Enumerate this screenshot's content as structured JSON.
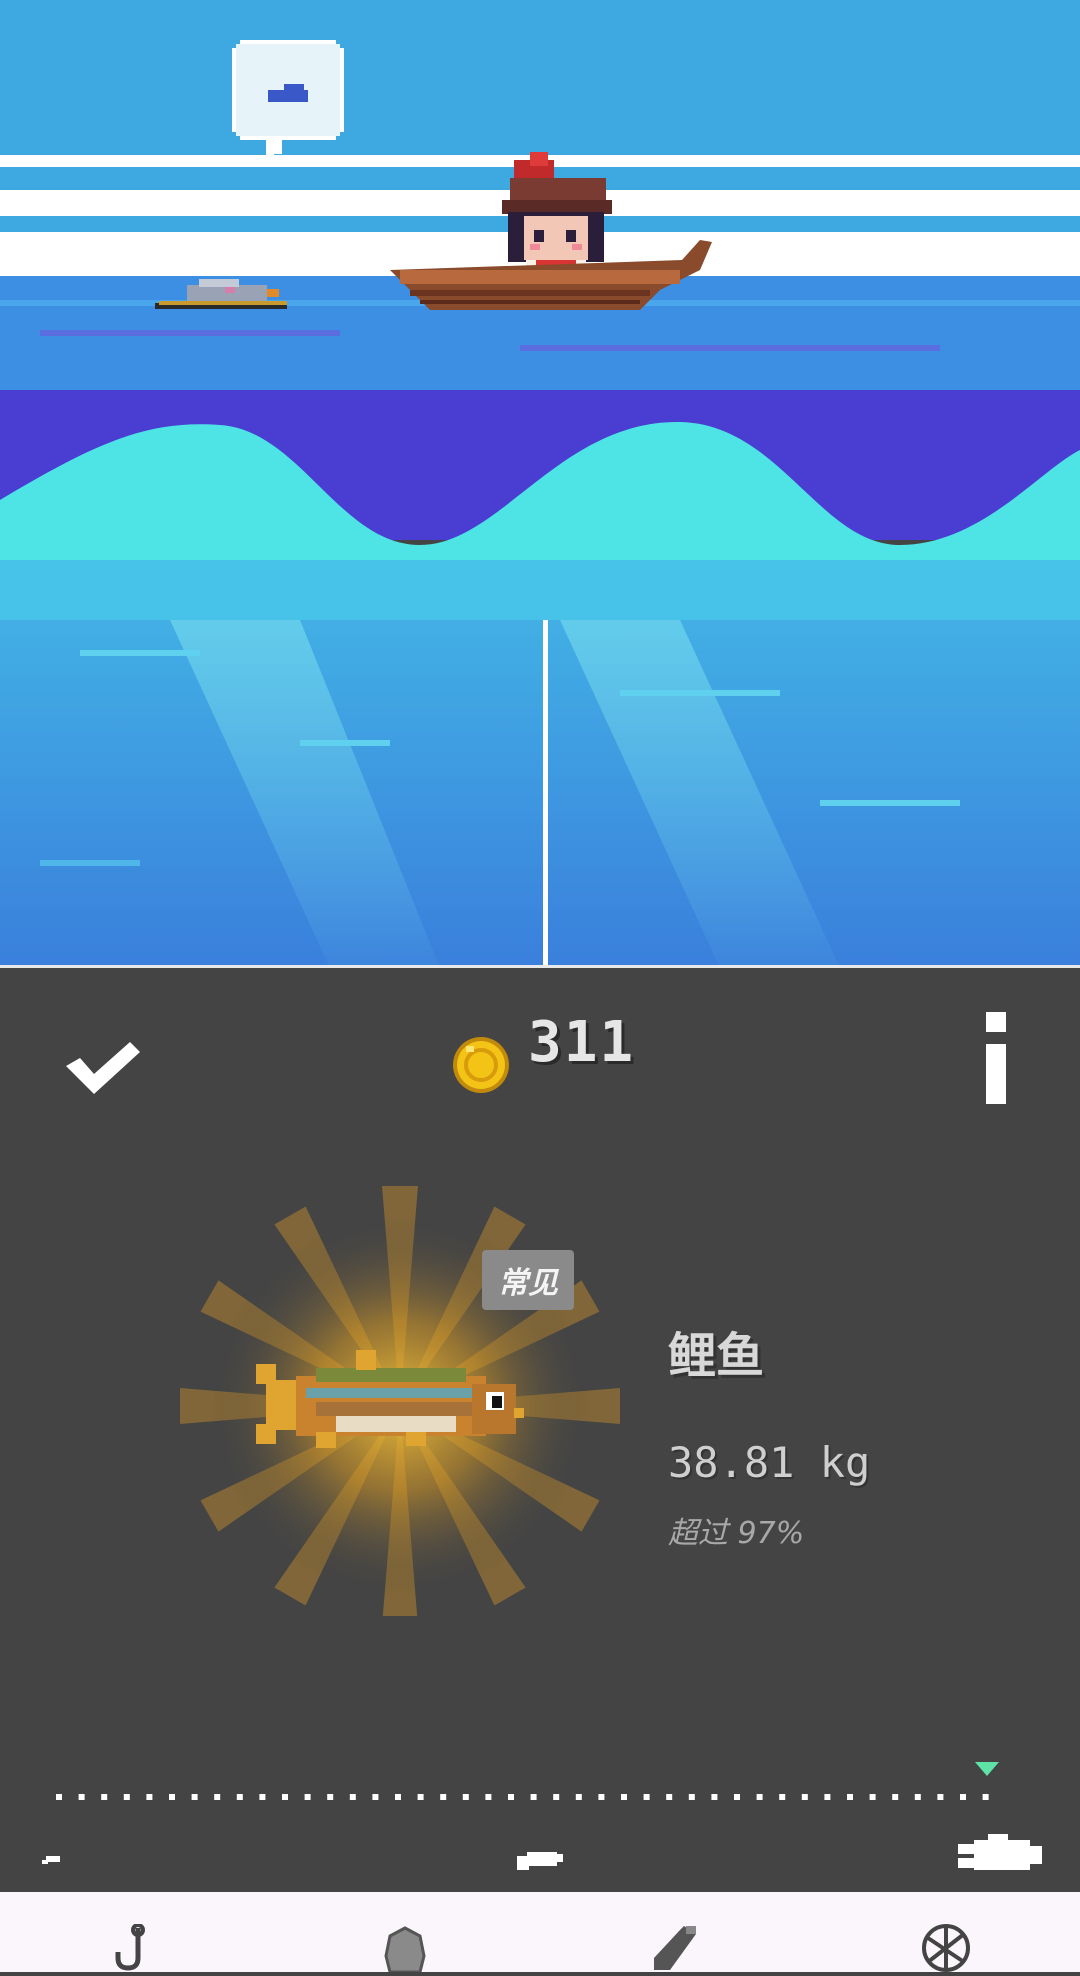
{
  "hud": {
    "coins": "311",
    "confirm_icon": "checkmark-icon",
    "info_icon": "info-icon",
    "coin_icon": "gold-coin-icon"
  },
  "catch": {
    "name": "鲤鱼",
    "weight": "38.81 kg",
    "percentile_text": "超过 97%",
    "rarity": "常见",
    "fish_icon": "carp-fish-icon"
  },
  "size_scale": {
    "marker_position": 0.98,
    "small_icon": "small-fish-icon",
    "medium_icon": "medium-fish-icon",
    "large_icon": "large-fish-icon"
  },
  "nav": {
    "items": [
      {
        "icon": "hook-icon"
      },
      {
        "icon": "stone-bait-icon"
      },
      {
        "icon": "bottle-icon"
      },
      {
        "icon": "net-ball-icon"
      }
    ]
  },
  "colors": {
    "sky": "#3ea9e1",
    "deep_band": "#4a3dd1",
    "wave": "#4ee4e6",
    "water": "#3b8fe0",
    "panel": "#444444",
    "coin": "#f3c316",
    "scale_marker": "#5ee2a6"
  }
}
